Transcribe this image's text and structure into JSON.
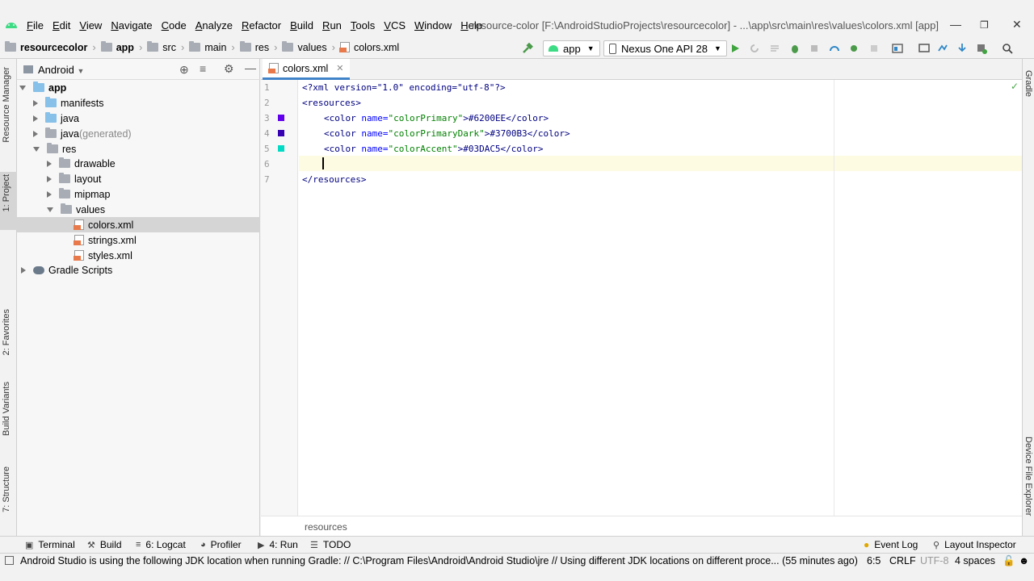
{
  "menubar": {
    "items": [
      "File",
      "Edit",
      "View",
      "Navigate",
      "Code",
      "Analyze",
      "Refactor",
      "Build",
      "Run",
      "Tools",
      "VCS",
      "Window",
      "Help"
    ],
    "title": "resource-color [F:\\AndroidStudioProjects\\resourcecolor] - ...\\app\\src\\main\\res\\values\\colors.xml [app]"
  },
  "breadcrumbs": [
    "resourcecolor",
    "app",
    "src",
    "main",
    "res",
    "values",
    "colors.xml"
  ],
  "toolbar": {
    "run_config": "app",
    "device": "Nexus One API 28"
  },
  "left_strip": [
    "1: Project",
    "Resource Manager",
    "2: Favorites",
    "Build Variants",
    "7: Structure"
  ],
  "right_strip": [
    "Gradle",
    "Device File Explorer"
  ],
  "project_panel": {
    "view_mode": "Android",
    "tree": [
      {
        "label": "app",
        "suffix": ""
      },
      {
        "label": "manifests",
        "suffix": ""
      },
      {
        "label": "java",
        "suffix": ""
      },
      {
        "label": "java",
        "suffix": " (generated)"
      },
      {
        "label": "res",
        "suffix": ""
      },
      {
        "label": "drawable",
        "suffix": ""
      },
      {
        "label": "layout",
        "suffix": ""
      },
      {
        "label": "mipmap",
        "suffix": ""
      },
      {
        "label": "values",
        "suffix": ""
      },
      {
        "label": "colors.xml",
        "suffix": ""
      },
      {
        "label": "strings.xml",
        "suffix": ""
      },
      {
        "label": "styles.xml",
        "suffix": ""
      },
      {
        "label": "Gradle Scripts",
        "suffix": ""
      }
    ]
  },
  "editor": {
    "tab": "colors.xml",
    "line_numbers": [
      "1",
      "2",
      "3",
      "4",
      "5",
      "6",
      "7"
    ],
    "lines": {
      "l1": "<?xml version=\"1.0\" encoding=\"utf-8\"?>",
      "l2": "<resources>",
      "l3a": "<color ",
      "l3b": "name=",
      "l3c": "\"colorPrimary\"",
      "l3d": ">#6200EE</color>",
      "l4a": "<color ",
      "l4b": "name=",
      "l4c": "\"colorPrimaryDark\"",
      "l4d": ">#3700B3</color>",
      "l5a": "<color ",
      "l5b": "name=",
      "l5c": "\"colorAccent\"",
      "l5d": ">#03DAC5</color>",
      "l7": "</resources>"
    },
    "swatches": [
      "#6200EE",
      "#3700B3",
      "#03DAC5"
    ],
    "footer_crumb": "resources"
  },
  "tool_windows": {
    "terminal": "Terminal",
    "build": "Build",
    "logcat": "6: Logcat",
    "profiler": "Profiler",
    "run": "4: Run",
    "todo": "TODO",
    "event_log": "Event Log",
    "layout_inspector": "Layout Inspector"
  },
  "status": {
    "message": "Android Studio is using the following JDK location when running Gradle: // C:\\Program Files\\Android\\Android Studio\\jre // Using different JDK locations on different proce... (55 minutes ago)",
    "position": "6:5",
    "line_sep": "CRLF",
    "encoding": "UTF-8",
    "indent": "4 spaces"
  }
}
